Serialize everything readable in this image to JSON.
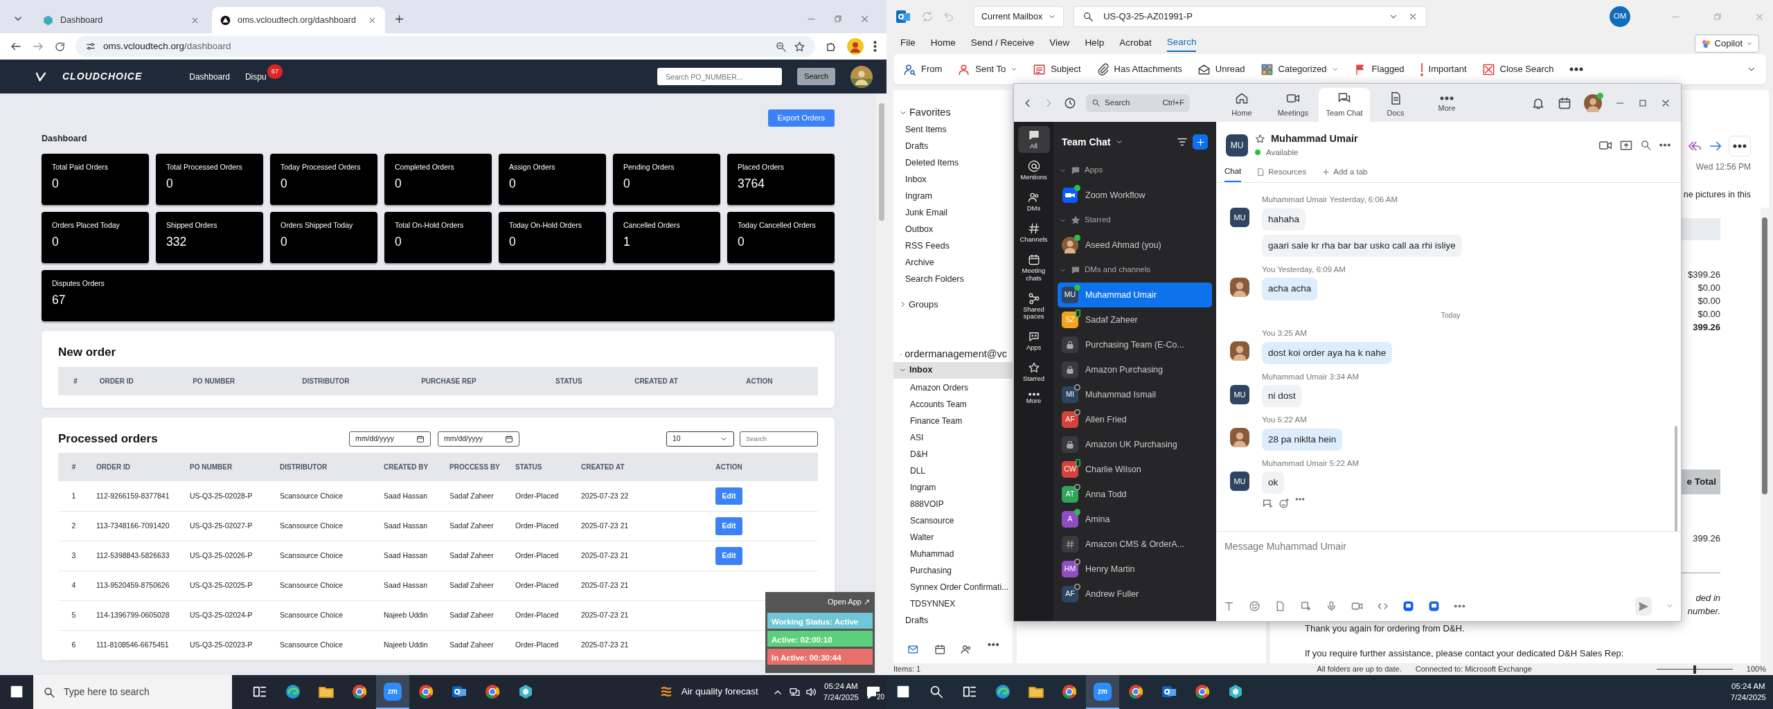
{
  "browser": {
    "tabs": [
      {
        "title": "Dashboard",
        "selected": false
      },
      {
        "title": "oms.vcloudtech.org/dashboard",
        "selected": true
      }
    ],
    "address": {
      "host": "oms.vcloudtech.org",
      "path": "/dashboard"
    },
    "site": {
      "logo": "CLOUDCHOICE",
      "nav": [
        {
          "label": "Dashboard"
        },
        {
          "label": "Dispu",
          "badge": "67"
        }
      ],
      "search_placeholder": "Search PO_NUMBER...",
      "search_button": "Search"
    },
    "export_button": "Export Orders",
    "heading": "Dashboard",
    "stats": [
      {
        "label": "Total Paid Orders",
        "value": "0"
      },
      {
        "label": "Total Processed Orders",
        "value": "0"
      },
      {
        "label": "Today Processed Orders",
        "value": "0"
      },
      {
        "label": "Completed Orders",
        "value": "0"
      },
      {
        "label": "Assign Orders",
        "value": "0"
      },
      {
        "label": "Pending Orders",
        "value": "0"
      },
      {
        "label": "Placed Orders",
        "value": "3764"
      },
      {
        "label": "Orders Placed Today",
        "value": "0"
      },
      {
        "label": "Shipped Orders",
        "value": "332"
      },
      {
        "label": "Orders Shipped Today",
        "value": "0"
      },
      {
        "label": "Total On-Hold Orders",
        "value": "0"
      },
      {
        "label": "Today On-Hold Orders",
        "value": "0"
      },
      {
        "label": "Cancelled Orders",
        "value": "1"
      },
      {
        "label": "Today Cancelled Orders",
        "value": "0"
      },
      {
        "label": "Disputes Orders",
        "value": "67"
      }
    ],
    "new_order": {
      "title": "New order",
      "columns": [
        "#",
        "ORDER ID",
        "PO NUMBER",
        "DISTRIBUTOR",
        "PURCHASE REP",
        "STATUS",
        "CREATED AT",
        "ACTION"
      ]
    },
    "processed": {
      "title": "Processed orders",
      "date_from": "mm/dd/yyyy",
      "date_to": "mm/dd/yyyy",
      "page_size": "10",
      "search_placeholder": "Search",
      "columns": [
        "#",
        "ORDER ID",
        "PO NUMBER",
        "DISTRIBUTOR",
        "CREATED BY",
        "PROCCESS BY",
        "STATUS",
        "CREATED AT",
        "ACTION"
      ],
      "rows": [
        {
          "cells": [
            "1",
            "112-9266159-8377841",
            "US-Q3-25-02028-P",
            "Scansource Choice",
            "Saad Hassan",
            "Sadaf Zaheer",
            "Order-Placed",
            "2025-07-23 22"
          ],
          "action": "Edit"
        },
        {
          "cells": [
            "2",
            "113-7348166-7091420",
            "US-Q3-25-02027-P",
            "Scansource Choice",
            "Saad Hassan",
            "Sadaf Zaheer",
            "Order-Placed",
            "2025-07-23 21"
          ],
          "action": "Edit"
        },
        {
          "cells": [
            "3",
            "112-5398843-5826633",
            "US-Q3-25-02026-P",
            "Scansource Choice",
            "Saad Hassan",
            "Sadaf Zaheer",
            "Order-Placed",
            "2025-07-23 21"
          ],
          "action": "Edit"
        },
        {
          "cells": [
            "4",
            "113-9520459-8750626",
            "US-Q3-25-02025-P",
            "Scansource Choice",
            "Saad Hassan",
            "Sadaf Zaheer",
            "Order-Placed",
            "2025-07-23 21"
          ]
        },
        {
          "cells": [
            "5",
            "114-1396799-0605028",
            "US-Q3-25-02024-P",
            "Scansource Choice",
            "Najeeb Uddin",
            "Sadaf Zaheer",
            "Order-Placed",
            "2025-07-23 21"
          ]
        },
        {
          "cells": [
            "6",
            "111-8108546-6675451",
            "US-Q3-25-02023-P",
            "Scansource Choice",
            "Najeeb Uddin",
            "Sadaf Zaheer",
            "Order-Placed",
            "2025-07-23 21"
          ]
        }
      ]
    },
    "status_widget": {
      "open_app": "Open App ↗",
      "lines": [
        {
          "text": "Working Status: Active",
          "color": "#6fc6d6"
        },
        {
          "text": "Active: 02:00:10",
          "color": "#5ccf7c"
        },
        {
          "text": "In Active: 00:30:44",
          "color": "#e8706a"
        }
      ]
    }
  },
  "outlook": {
    "search_scope": "Current Mailbox",
    "search_query": "US-Q3-25-AZ01991-P",
    "account_initials": "OM",
    "copilot": "Copilot",
    "menu": [
      {
        "label": "File",
        "selected": false
      },
      {
        "label": "Home",
        "selected": false
      },
      {
        "label": "Send / Receive",
        "selected": false
      },
      {
        "label": "View",
        "selected": false
      },
      {
        "label": "Help",
        "selected": false
      },
      {
        "label": "Acrobat",
        "selected": false
      },
      {
        "label": "Search",
        "selected": true
      }
    ],
    "ribbon": [
      {
        "label": "From",
        "dropdown": false
      },
      {
        "label": "Sent To",
        "dropdown": true
      },
      {
        "label": "Subject",
        "dropdown": false
      },
      {
        "label": "Has Attachments",
        "dropdown": false
      },
      {
        "label": "Unread",
        "dropdown": false
      },
      {
        "label": "Categorized",
        "dropdown": true
      },
      {
        "label": "Flagged",
        "dropdown": false
      },
      {
        "label": "Important",
        "dropdown": false
      },
      {
        "label": "Close Search",
        "dropdown": false
      }
    ],
    "favorites": {
      "title": "Favorites",
      "items": [
        "Sent Items",
        "Drafts",
        "Deleted Items",
        "Inbox",
        "Ingram"
      ]
    },
    "folders": [
      "Junk Email",
      "Outbox",
      "RSS Feeds",
      "Archive",
      "Search Folders"
    ],
    "groups": "Groups",
    "account": "ordermanagement@vc",
    "inbox": {
      "label": "Inbox",
      "expanded": true,
      "selected": true,
      "children": [
        "Amazon Orders",
        "Accounts Team",
        "Finance Team",
        "ASI",
        "D&H",
        "DLL",
        "Ingram",
        "888VOIP",
        "Scansource",
        "Walter",
        "Muhammad",
        "Purchasing",
        "Synnex Order Confirmati...",
        "TDSYNNEX"
      ]
    },
    "after_inbox": [
      "Drafts"
    ],
    "reading": {
      "date": "Wed 12:56 PM",
      "notice": "ne pictures in this",
      "amounts": [
        {
          "text": "$399.26",
          "bold": false
        },
        {
          "text": "$0.00",
          "bold": false
        },
        {
          "text": "$0.00",
          "bold": false
        },
        {
          "text": "$0.00",
          "bold": false
        },
        {
          "text": "399.26",
          "bold": true
        }
      ],
      "total_header": "e Total",
      "line_total": "399.26",
      "note": [
        "ded in",
        "number."
      ],
      "closing": [
        "Thank you again for ordering from D&H.",
        "If you require further assistance, please contact your dedicated D&H Sales Rep:"
      ]
    },
    "status": {
      "items": "Items: 1",
      "sync": "All folders are up to date.",
      "connection": "Connected to: Microsoft Exchange",
      "zoom": "100%",
      "level": 0.5
    }
  },
  "zoom": {
    "search": "Search",
    "shortcut": "Ctrl+F",
    "tabs": [
      {
        "label": "Home",
        "selected": false
      },
      {
        "label": "Meetings",
        "selected": false
      },
      {
        "label": "Team Chat",
        "selected": true
      },
      {
        "label": "Docs",
        "selected": false
      },
      {
        "label": "More",
        "selected": false
      }
    ],
    "rail": [
      {
        "label": "All",
        "selected": true
      },
      {
        "label": "Mentions",
        "selected": false
      },
      {
        "label": "DMs",
        "selected": false
      },
      {
        "label": "Channels",
        "selected": false
      },
      {
        "label": "Meeting chats",
        "selected": false
      },
      {
        "label": "Shared spaces",
        "selected": false
      },
      {
        "label": "Apps",
        "selected": false
      },
      {
        "label": "Starred",
        "selected": false
      },
      {
        "label": "More",
        "selected": false
      }
    ],
    "list_title": "Team Chat",
    "sections": [
      {
        "title": "Apps",
        "items": [
          {
            "name": "Zoom Workflow",
            "kind": "app",
            "online": true,
            "mobile": false,
            "selected": false
          }
        ]
      },
      {
        "title": "Starred",
        "items": [
          {
            "name": "Aseed Ahmad (you)",
            "kind": "photo",
            "online": true,
            "mobile": false,
            "selected": false
          }
        ]
      },
      {
        "title": "DMs and channels",
        "items": [
          {
            "name": "Muhammad Umair",
            "kind": "initials",
            "initials": "MU",
            "color": "#2e4461",
            "online": true,
            "mobile": false,
            "selected": true
          },
          {
            "name": "Sadaf Zaheer",
            "kind": "initials",
            "initials": "SZ",
            "color": "#f0a51c",
            "online": true,
            "mobile": true,
            "selected": false
          },
          {
            "name": "Purchasing Team (E-Co...",
            "kind": "lock",
            "selected": false
          },
          {
            "name": "Amazon Purchasing",
            "kind": "lock",
            "selected": false
          },
          {
            "name": "Muhammad Ismail",
            "kind": "initials",
            "initials": "MI",
            "color": "#2e4461",
            "online": false,
            "mobile": false,
            "selected": false
          },
          {
            "name": "Allen Fried",
            "kind": "initials",
            "initials": "AF",
            "color": "#d4423a",
            "online": false,
            "mobile": false,
            "selected": false
          },
          {
            "name": "Amazon UK Purchasing",
            "kind": "lock",
            "selected": false
          },
          {
            "name": "Charlie Wilson",
            "kind": "initials",
            "initials": "CW",
            "color": "#d4423a",
            "online": true,
            "mobile": true,
            "selected": false
          },
          {
            "name": "Anna Todd",
            "kind": "initials",
            "initials": "AT",
            "color": "#2fa55a",
            "online": false,
            "mobile": false,
            "selected": false
          },
          {
            "name": "Amina",
            "kind": "initials",
            "initials": "A",
            "color": "#8e4dc3",
            "online": true,
            "mobile": false,
            "selected": false
          },
          {
            "name": "Amazon CMS & OrderA...",
            "kind": "hash",
            "selected": false
          },
          {
            "name": "Henry Martin",
            "kind": "initials",
            "initials": "HM",
            "color": "#8e4dc3",
            "online": false,
            "mobile": false,
            "selected": false
          },
          {
            "name": "Andrew Fuller",
            "kind": "initials",
            "initials": "AF",
            "color": "#2e4461",
            "online": false,
            "mobile": false,
            "selected": false
          }
        ]
      }
    ],
    "chat": {
      "name": "Muhammad Umair",
      "initials": "MU",
      "status": "Available",
      "tabs": [
        {
          "label": "Chat",
          "selected": true
        },
        {
          "label": "Resources",
          "selected": false
        },
        {
          "label": "Add a tab",
          "selected": false
        }
      ],
      "messages": [
        {
          "kind": "message",
          "sender": "Muhammad Umair",
          "initials": "MU",
          "time": "Yesterday, 6:06 AM",
          "mine": false,
          "bubbles": [
            "hahaha",
            "gaari sale kr rha bar bar usko call aa rhi isliye"
          ]
        },
        {
          "kind": "message",
          "sender": "You",
          "time": "Yesterday, 6:09 AM",
          "mine": true,
          "bubbles": [
            "acha acha"
          ]
        },
        {
          "kind": "divider",
          "label": "Today"
        },
        {
          "kind": "message",
          "sender": "You",
          "time": "3:25 AM",
          "mine": true,
          "bubbles": [
            "dost koi order aya ha k nahe"
          ]
        },
        {
          "kind": "message",
          "sender": "Muhammad Umair",
          "initials": "MU",
          "time": "3:34 AM",
          "mine": false,
          "bubbles": [
            "ni dost"
          ]
        },
        {
          "kind": "message",
          "sender": "You",
          "time": "5:22 AM",
          "mine": true,
          "bubbles": [
            "28 pa niklta hein"
          ]
        },
        {
          "kind": "message",
          "sender": "Muhammad Umair",
          "initials": "MU",
          "time": "5:22 AM",
          "mine": false,
          "bubbles": [
            "ok"
          ]
        }
      ],
      "composer_placeholder": "Message Muhammad Umair"
    }
  },
  "taskbars": [
    {
      "search_placeholder": "Type here to search",
      "apps": [
        {
          "kind": "taskview",
          "selected": false
        },
        {
          "kind": "edge",
          "selected": false
        },
        {
          "kind": "explorer",
          "selected": false
        },
        {
          "kind": "chrome",
          "selected": false
        },
        {
          "kind": "zoom",
          "label": "zm",
          "selected": true
        },
        {
          "kind": "chrome",
          "selected": false
        },
        {
          "kind": "outlook",
          "selected": false
        },
        {
          "kind": "chrome",
          "selected": false
        },
        {
          "kind": "gem",
          "selected": false
        }
      ],
      "weather": "Air quality forecast",
      "time": "05:24 AM",
      "date": "7/24/2025",
      "notifications": "20"
    },
    {
      "apps": [
        {
          "kind": "search",
          "selected": false
        },
        {
          "kind": "taskview",
          "selected": false
        },
        {
          "kind": "edge",
          "selected": false
        },
        {
          "kind": "explorer",
          "selected": false
        },
        {
          "kind": "chrome",
          "selected": false
        },
        {
          "kind": "zoom",
          "label": "zm",
          "selected": true
        },
        {
          "kind": "chrome",
          "selected": false
        },
        {
          "kind": "outlook",
          "selected": false
        },
        {
          "kind": "chrome",
          "selected": false
        },
        {
          "kind": "gem",
          "selected": false
        }
      ],
      "time": "05:24 AM",
      "date": "7/24/2025"
    }
  ]
}
